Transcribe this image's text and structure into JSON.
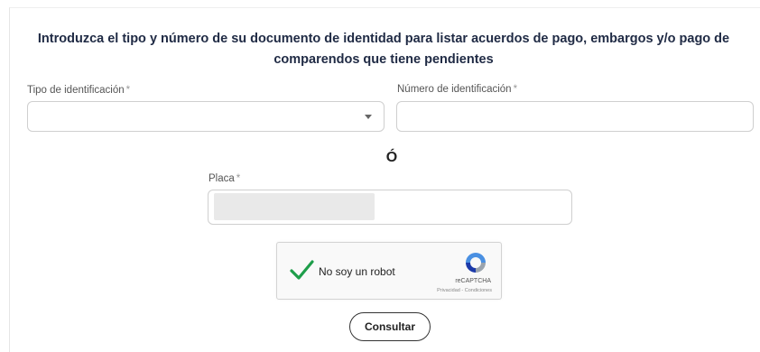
{
  "form": {
    "heading": "Introduzca el tipo y número de su documento de identidad para listar acuerdos de pago, embargos y/o pago de comparendos que tiene pendientes",
    "id_type": {
      "label": "Tipo de identificación",
      "required_mark": "*",
      "value": ""
    },
    "id_number": {
      "label": "Número de identificación",
      "required_mark": "*",
      "value": ""
    },
    "separator": "Ó",
    "plate": {
      "label": "Placa",
      "required_mark": "*",
      "value": ""
    },
    "captcha": {
      "label": "No soy un robot",
      "checked": true,
      "brand": "reCAPTCHA",
      "terms": "Privacidad - Condiciones"
    },
    "submit_label": "Consultar"
  },
  "colors": {
    "check": "#1e9e4a",
    "heading": "#1f2a44",
    "border": "#cfcfcf"
  }
}
